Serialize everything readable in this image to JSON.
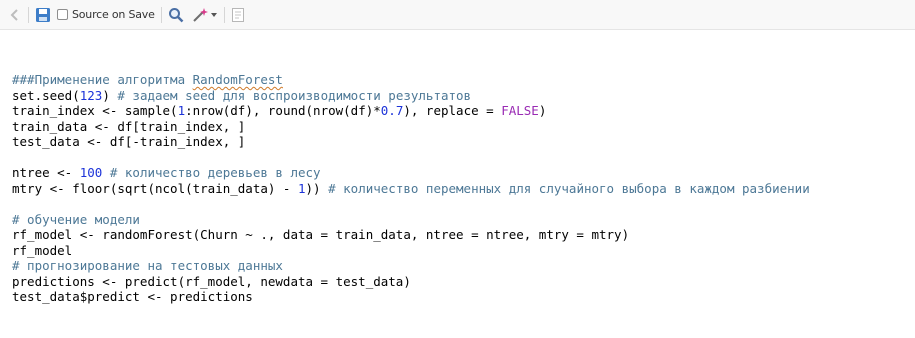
{
  "toolbar": {
    "source_on_save_label": "Source on Save",
    "icons": [
      "navigate-back-icon",
      "save-icon",
      "search-icon",
      "code-tools-icon",
      "dropdown-arrow-icon",
      "document-outline-icon"
    ]
  },
  "code": {
    "lines": [
      {
        "parts": [
          {
            "t": "###Применение алгоритма ",
            "c": "cm"
          },
          {
            "t": "RandomForest",
            "c": "cm uline"
          }
        ]
      },
      {
        "parts": [
          {
            "t": "set.seed(",
            "c": ""
          },
          {
            "t": "123",
            "c": "num"
          },
          {
            "t": ") ",
            "c": ""
          },
          {
            "t": "# задаем seed для воспроизводимости результатов",
            "c": "cm"
          }
        ]
      },
      {
        "parts": [
          {
            "t": "train_index <- sample(",
            "c": ""
          },
          {
            "t": "1",
            "c": "num"
          },
          {
            "t": ":nrow(df), round(nrow(df)*",
            "c": ""
          },
          {
            "t": "0.7",
            "c": "num"
          },
          {
            "t": "), replace = ",
            "c": ""
          },
          {
            "t": "FALSE",
            "c": "kw"
          },
          {
            "t": ")",
            "c": ""
          }
        ]
      },
      {
        "parts": [
          {
            "t": "train_data <- df[train_index, ]",
            "c": ""
          }
        ]
      },
      {
        "parts": [
          {
            "t": "test_data <- df[-train_index, ]",
            "c": ""
          }
        ]
      },
      {
        "parts": [
          {
            "t": "",
            "c": ""
          }
        ]
      },
      {
        "parts": [
          {
            "t": "ntree <- ",
            "c": ""
          },
          {
            "t": "100",
            "c": "num"
          },
          {
            "t": " ",
            "c": ""
          },
          {
            "t": "# количество деревьев в лесу",
            "c": "cm"
          }
        ]
      },
      {
        "parts": [
          {
            "t": "mtry <- floor(sqrt(ncol(train_data) - ",
            "c": ""
          },
          {
            "t": "1",
            "c": "num"
          },
          {
            "t": ")) ",
            "c": ""
          },
          {
            "t": "# количество переменных для случайного выбора в каждом разбиении",
            "c": "cm"
          }
        ]
      },
      {
        "parts": [
          {
            "t": "",
            "c": ""
          }
        ]
      },
      {
        "parts": [
          {
            "t": "# обучение модели",
            "c": "cm"
          }
        ]
      },
      {
        "parts": [
          {
            "t": "rf_model <- randomForest(Churn ~ ., data = train_data, ntree = ntree, mtry = mtry)",
            "c": ""
          }
        ]
      },
      {
        "parts": [
          {
            "t": "rf_model",
            "c": ""
          }
        ]
      },
      {
        "parts": [
          {
            "t": "# прогнозирование на тестовых данных",
            "c": "cm"
          }
        ]
      },
      {
        "parts": [
          {
            "t": "predictions <- predict(rf_model, newdata = test_data)",
            "c": ""
          }
        ]
      },
      {
        "parts": [
          {
            "t": "test_data$predict <- predictions",
            "c": ""
          }
        ]
      }
    ]
  }
}
